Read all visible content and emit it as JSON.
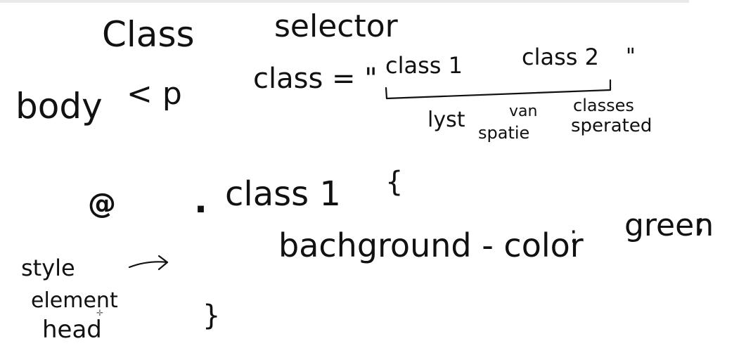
{
  "notes": {
    "title_word1": "Class",
    "title_word2": "selector",
    "body": "body",
    "p_tag": "< p",
    "class_eq": "class = \"",
    "class1": "class 1",
    "class2": "class 2",
    "close_quote": "\"",
    "lyst": "lyst",
    "van": "van",
    "spatie": "spatie",
    "classes": "classes",
    "sperated": "sperated",
    "selector_dot": ".",
    "selector_name": "class 1",
    "open_brace": "{",
    "at_symbol": "@",
    "property": "bachground - color",
    "colon": ":",
    "value": "green",
    "semicolon": ";",
    "style": "style",
    "element": "element",
    "head": "head",
    "arrow": "→",
    "close_brace": "}"
  },
  "cursor_icon": "crosshair-cursor-icon"
}
